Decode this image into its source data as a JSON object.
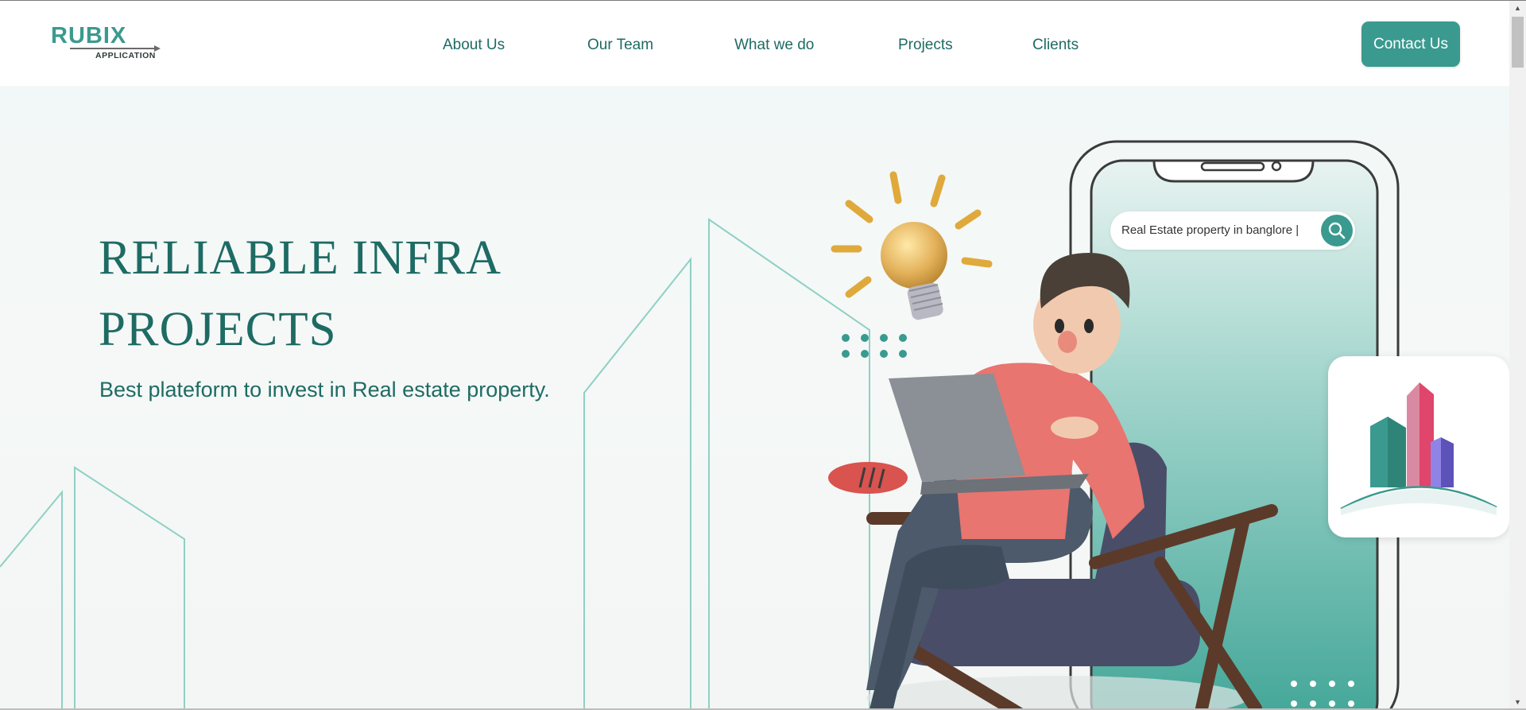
{
  "header": {
    "logo": {
      "title": "RUBIX",
      "subtitle": "APPLICATION"
    },
    "nav": [
      {
        "label": "About Us"
      },
      {
        "label": "Our Team"
      },
      {
        "label": "What we do"
      },
      {
        "label": "Projects"
      },
      {
        "label": "Clients"
      }
    ],
    "contact_label": "Contact Us"
  },
  "hero": {
    "title_line1": "RELIABLE INFRA",
    "title_line2": "PROJECTS",
    "subtitle": "Best plateform to invest in Real estate property.",
    "search_text": "Real Estate property in banglore |"
  },
  "colors": {
    "brand": "#3a9a8f",
    "text": "#1e6b64",
    "accent_pink": "#e0456b",
    "accent_purple": "#6a5acd"
  },
  "icons": [
    "search-icon",
    "light-bulb-icon",
    "buildings-logo-icon",
    "scroll-up-icon",
    "scroll-down-icon"
  ]
}
